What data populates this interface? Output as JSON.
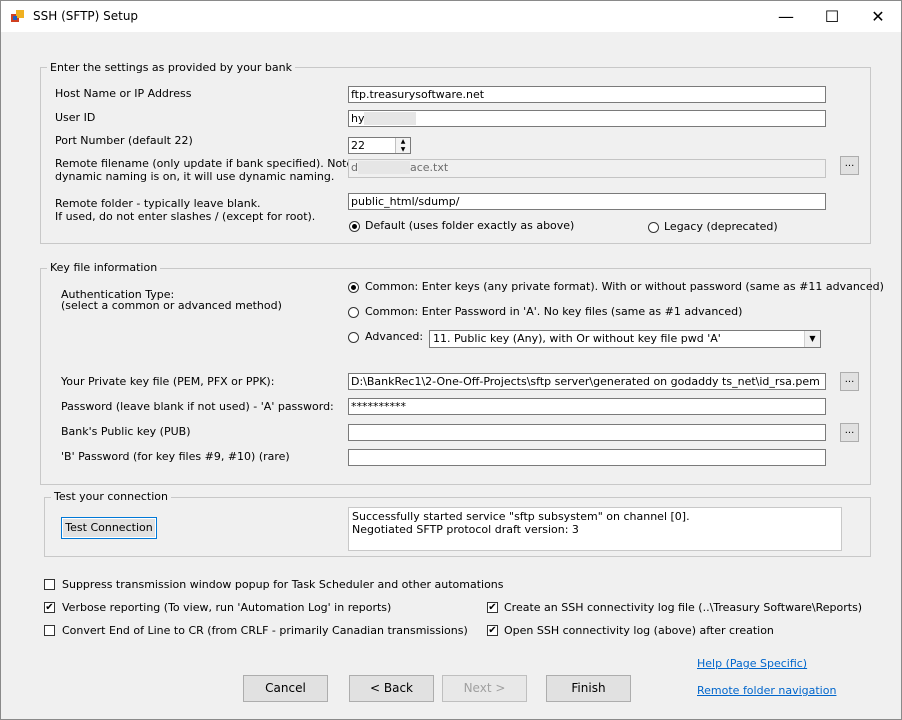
{
  "window": {
    "title": "SSH (SFTP) Setup",
    "minimize": "—",
    "maximize": "☐",
    "close": "✕"
  },
  "bank_settings": {
    "legend": "Enter the settings as provided by your bank",
    "host_label": "Host Name or IP Address",
    "host_value": "ftp.treasurysoftware.net",
    "userid_label": "User ID",
    "userid_value": "hy",
    "port_label": "Port Number (default 22)",
    "port_value": "22",
    "remote_filename_label_1": "Remote filename (only update if bank specified). Note: If",
    "remote_filename_label_2": "dynamic naming is on, it will use dynamic naming.",
    "remote_filename_value_start": "d",
    "remote_filename_value_end": "ace.txt",
    "remote_folder_label_1": "Remote folder - typically leave blank.",
    "remote_folder_label_2": "If used, do not enter slashes / (except for root).",
    "remote_folder_value": "public_html/sdump/",
    "radio_default": "Default (uses folder exactly as above)",
    "radio_legacy": "Legacy (deprecated)",
    "browse": "..."
  },
  "key_file": {
    "legend": "Key file information",
    "auth_label_1": "Authentication Type:",
    "auth_label_2": "(select a common or advanced method)",
    "radio_common_keys": "Common: Enter keys (any private format). With or without password (same as #11 advanced)",
    "radio_common_password": "Common: Enter Password in 'A'. No key files (same as #1 advanced)",
    "radio_advanced": "Advanced:",
    "advanced_select": "11. Public key (Any), with Or without key file pwd 'A'",
    "private_key_label": "Your Private key file (PEM, PFX or PPK):",
    "private_key_value": "D:\\BankRec1\\2-One-Off-Projects\\sftp server\\generated on godaddy ts_net\\id_rsa.pem",
    "password_label": "Password (leave blank if not used) - 'A' password:",
    "password_value": "**********",
    "public_key_label": "Bank's Public key (PUB)",
    "public_key_value": "",
    "b_password_label": "'B' Password (for key files #9, #10) (rare)",
    "b_password_value": "",
    "browse": "..."
  },
  "test": {
    "legend": "Test your connection",
    "button": "Test Connection",
    "log": "Successfully started service \"sftp subsystem\" on channel [0].\nNegotiated SFTP protocol draft version: 3"
  },
  "options": {
    "suppress": "Suppress transmission window popup for Task Scheduler and other automations",
    "verbose": "Verbose reporting (To view, run 'Automation Log' in reports)",
    "convert_eol": "Convert End of Line to CR (from CRLF - primarily Canadian transmissions)",
    "create_log": "Create an SSH connectivity log file (..\\Treasury Software\\Reports)",
    "open_log": "Open SSH connectivity log (above) after creation",
    "checkmark": "✔"
  },
  "links": {
    "help": "Help (Page Specific)",
    "remote_nav": "Remote folder navigation"
  },
  "buttons": {
    "cancel": "Cancel",
    "back": "< Back",
    "next": "Next >",
    "finish": "Finish"
  }
}
